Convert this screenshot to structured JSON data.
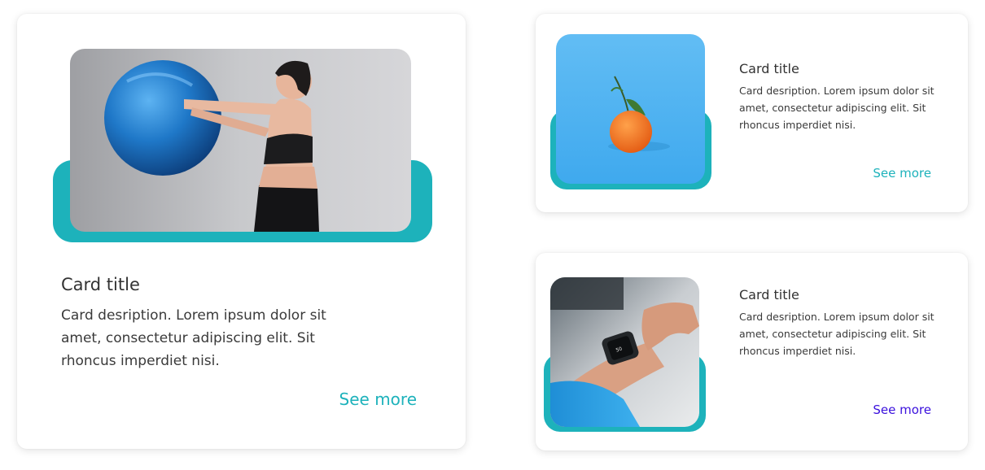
{
  "cards": [
    {
      "title": "Card title",
      "description": "Card desription. Lorem ipsum dolor sit amet, consectetur adipiscing elit. Sit rhoncus imperdiet nisi.",
      "link_label": "See more",
      "link_color": "#1db2bb",
      "image": "woman-exercise-ball-photo"
    },
    {
      "title": "Card title",
      "description": "Card desription. Lorem ipsum dolor sit amet, consectetur adipiscing elit. Sit rhoncus imperdiet nisi.",
      "link_label": "See more",
      "link_color": "#1db2bb",
      "image": "tangerine-photo"
    },
    {
      "title": "Card title",
      "description": "Card desription. Lorem ipsum dolor sit amet, consectetur adipiscing elit. Sit rhoncus imperdiet nisi.",
      "link_label": "See more",
      "link_color": "#3a10dd",
      "image": "smartwatch-photo"
    }
  ],
  "colors": {
    "accent": "#1db2bb",
    "link_alt": "#3a10dd",
    "text": "#333333"
  }
}
